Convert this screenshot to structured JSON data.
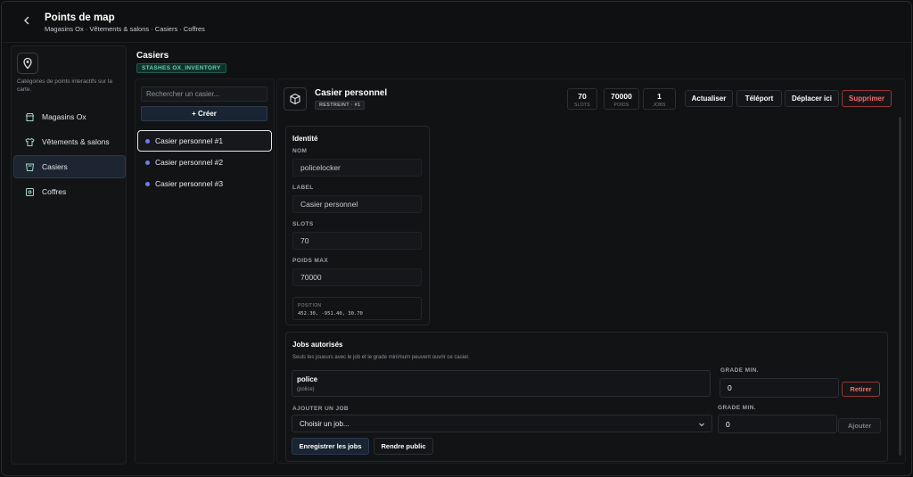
{
  "header": {
    "title": "Points de map",
    "breadcrumb": "Magasins Ox · Vêtements & salons · Casiers · Coffres"
  },
  "sidebar": {
    "description": "Catégories de points interactifs sur la carte.",
    "items": [
      {
        "label": "Magasins Ox",
        "icon": "store-icon"
      },
      {
        "label": "Vêtements & salons",
        "icon": "shirt-icon"
      },
      {
        "label": "Casiers",
        "icon": "locker-icon",
        "active": true
      },
      {
        "label": "Coffres",
        "icon": "safe-icon"
      }
    ]
  },
  "section": {
    "title": "Casiers",
    "tag": "STASHES OX_INVENTORY"
  },
  "list": {
    "search_placeholder": "Rechercher un casier...",
    "create_label": "+ Créer",
    "items": [
      {
        "label": "Casier personnel  #1",
        "active": true
      },
      {
        "label": "Casier personnel  #2"
      },
      {
        "label": "Casier personnel  #3"
      }
    ]
  },
  "detail": {
    "title": "Casier personnel",
    "tag": "RESTREINT · #1",
    "stats": [
      {
        "value": "70",
        "label": "SLOTS"
      },
      {
        "value": "70000",
        "label": "POIDS"
      },
      {
        "value": "1",
        "label": "JOBS"
      }
    ],
    "actions": {
      "refresh": "Actualiser",
      "teleport": "Téléport",
      "move": "Déplacer ici",
      "delete": "Supprimer"
    },
    "identity": {
      "title": "Identité",
      "name_label": "NOM",
      "name_value": "policelocker",
      "label_label": "LABEL",
      "label_value": "Casier personnel",
      "slots_label": "SLOTS",
      "slots_value": "70",
      "weight_label": "POIDS MAX",
      "weight_value": "70000",
      "position_label": "POSITION",
      "position_value": "452.30, -951.40, 30.70"
    },
    "jobs": {
      "title": "Jobs autorisés",
      "subtitle": "Seuls les joueurs avec le job et le grade minimum peuvent ouvrir ce casier.",
      "entries": [
        {
          "name": "police",
          "sub": "(police)",
          "grade": "0"
        }
      ],
      "grade_label": "GRADE MIN.",
      "remove_label": "Retirer",
      "add_label": "AJOUTER UN JOB",
      "select_value": "Choisir un job...",
      "add_grade_label": "GRADE MIN.",
      "add_grade_value": "0",
      "add_button": "Ajouter",
      "save_button": "Enregistrer les jobs",
      "public_button": "Rendre public"
    }
  }
}
